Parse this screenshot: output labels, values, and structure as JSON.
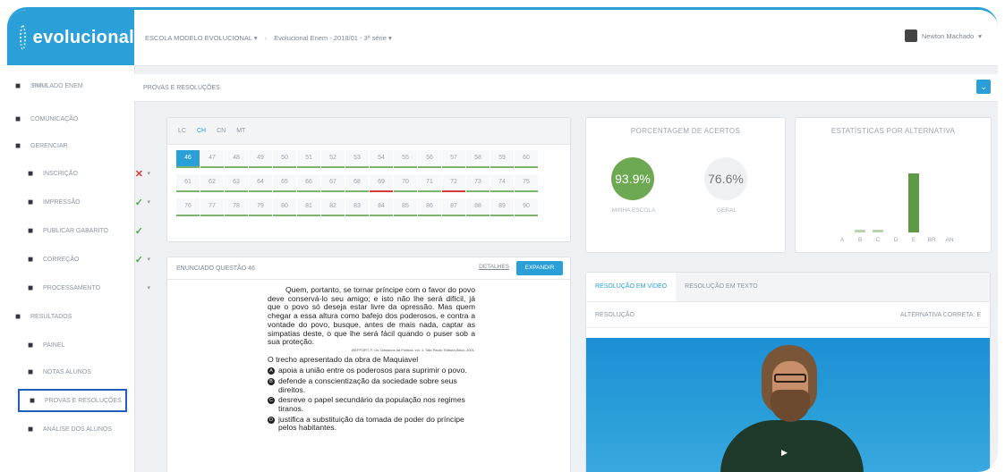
{
  "app": {
    "logo_text": "evolucional"
  },
  "topbar": {
    "school": "ESCOLA MODELO EVOLUCIONAL",
    "exam": "Evolucional Enem - 2018/01 - 3ª série",
    "user": "Newton Machado"
  },
  "sidebar": {
    "items": [
      {
        "label": "SIMULADO ENEM",
        "icon": "document-icon"
      },
      {
        "label": "COMUNICAÇÃO",
        "icon": "megaphone-icon"
      },
      {
        "label": "GERENCIAR",
        "icon": "bars-icon"
      },
      {
        "label": "INSCRIÇÃO",
        "icon": "user-add-icon",
        "status": "✕",
        "status_color": "#d43a3a"
      },
      {
        "label": "IMPRESSÃO",
        "icon": "printer-icon",
        "status": "✓",
        "status_color": "#5aa642"
      },
      {
        "label": "PUBLICAR GABARITO",
        "icon": "share-icon",
        "status": "✓",
        "status_color": "#5aa642"
      },
      {
        "label": "CORREÇÃO",
        "icon": "check-square-icon",
        "status": "✓",
        "status_color": "#5aa642"
      },
      {
        "label": "PROCESSAMENTO",
        "icon": "gears-icon"
      },
      {
        "label": "RESULTADOS",
        "icon": "chart-icon"
      },
      {
        "label": "PAINEL",
        "icon": "dashboard-icon"
      },
      {
        "label": "NOTAS ALUNOS",
        "icon": "id-card-icon"
      },
      {
        "label": "PROVAS E RESOLUÇÕES",
        "icon": "list-icon"
      },
      {
        "label": "ANÁLISE DOS ALUNOS",
        "icon": "user-chart-icon"
      }
    ],
    "small_subtitle": "PROVA"
  },
  "page": {
    "title": "PROVAS E RESOLUÇÕES"
  },
  "subjects": [
    "LC",
    "CH",
    "CN",
    "MT"
  ],
  "selected_subject": "CH",
  "question_grid": {
    "rows": [
      [
        "46",
        "47",
        "48",
        "49",
        "50",
        "51",
        "52",
        "53",
        "54",
        "55",
        "56",
        "57",
        "58",
        "59",
        "60"
      ],
      [
        "61",
        "62",
        "63",
        "64",
        "65",
        "66",
        "67",
        "68",
        "69",
        "70",
        "71",
        "72",
        "73",
        "74",
        "75"
      ],
      [
        "76",
        "77",
        "78",
        "79",
        "80",
        "81",
        "82",
        "83",
        "84",
        "85",
        "86",
        "87",
        "88",
        "89",
        "90"
      ]
    ],
    "selected": "46",
    "wrong": [
      "69",
      "72"
    ]
  },
  "accuracy": {
    "title": "PORCENTAGEM DE ACERTOS",
    "school_value": "93.9%",
    "school_label": "MINHA ESCOLA",
    "general_value": "76.6%",
    "general_label": "GERAL"
  },
  "alt_stats": {
    "title": "ESTATÍSTICAS POR ALTERNATIVA"
  },
  "chart_data": {
    "type": "bar",
    "title": "ESTATÍSTICAS POR ALTERNATIVA",
    "categories": [
      "A",
      "B",
      "C",
      "D",
      "E",
      "BR",
      "AN"
    ],
    "values": [
      0,
      3,
      3,
      0,
      94,
      0,
      0
    ],
    "highlight": "E"
  },
  "question": {
    "header": "ENUNCIADO QUESTÃO 46",
    "details": "DETALHES",
    "expand": "EXPANDIR",
    "paragraph": "Quem, portanto, se tornar príncipe com o favor do povo deve conservá-lo seu amigo; e isto não lhe será difícil, já que o povo só deseja estar livre da opressão. Mas quem chegar a essa altura como bafejo dos poderosos, e contra a vontade do povo, busque, antes de mais nada, captar as simpatias deste, o que lhe será fácil quando o puser sob a sua proteção.",
    "reference": "WEFFORT, F. Os Clássicos da Política. vol. 1. São Paulo: Editora Ática, 2001.",
    "prompt": "O trecho apresentado da obra de Maquiavel",
    "options": [
      {
        "letter": "A",
        "text": "apoia a união entre os poderosos para suprimir o povo."
      },
      {
        "letter": "B",
        "text": "defende a conscientização da sociedade sobre seus direitos."
      },
      {
        "letter": "C",
        "text": "desreve o papel secundário da população nos regimes tiranos."
      },
      {
        "letter": "D",
        "text": "justifica a substituição da tomada de poder do príncipe pelos habitantes."
      }
    ]
  },
  "resolution": {
    "tab_video": "RESOLUÇÃO EM VÍDEO",
    "tab_text": "RESOLUÇÃO EM TEXTO",
    "label": "RESOLUÇÃO",
    "correct": "ALTERNATIVA CORRETA: E"
  }
}
